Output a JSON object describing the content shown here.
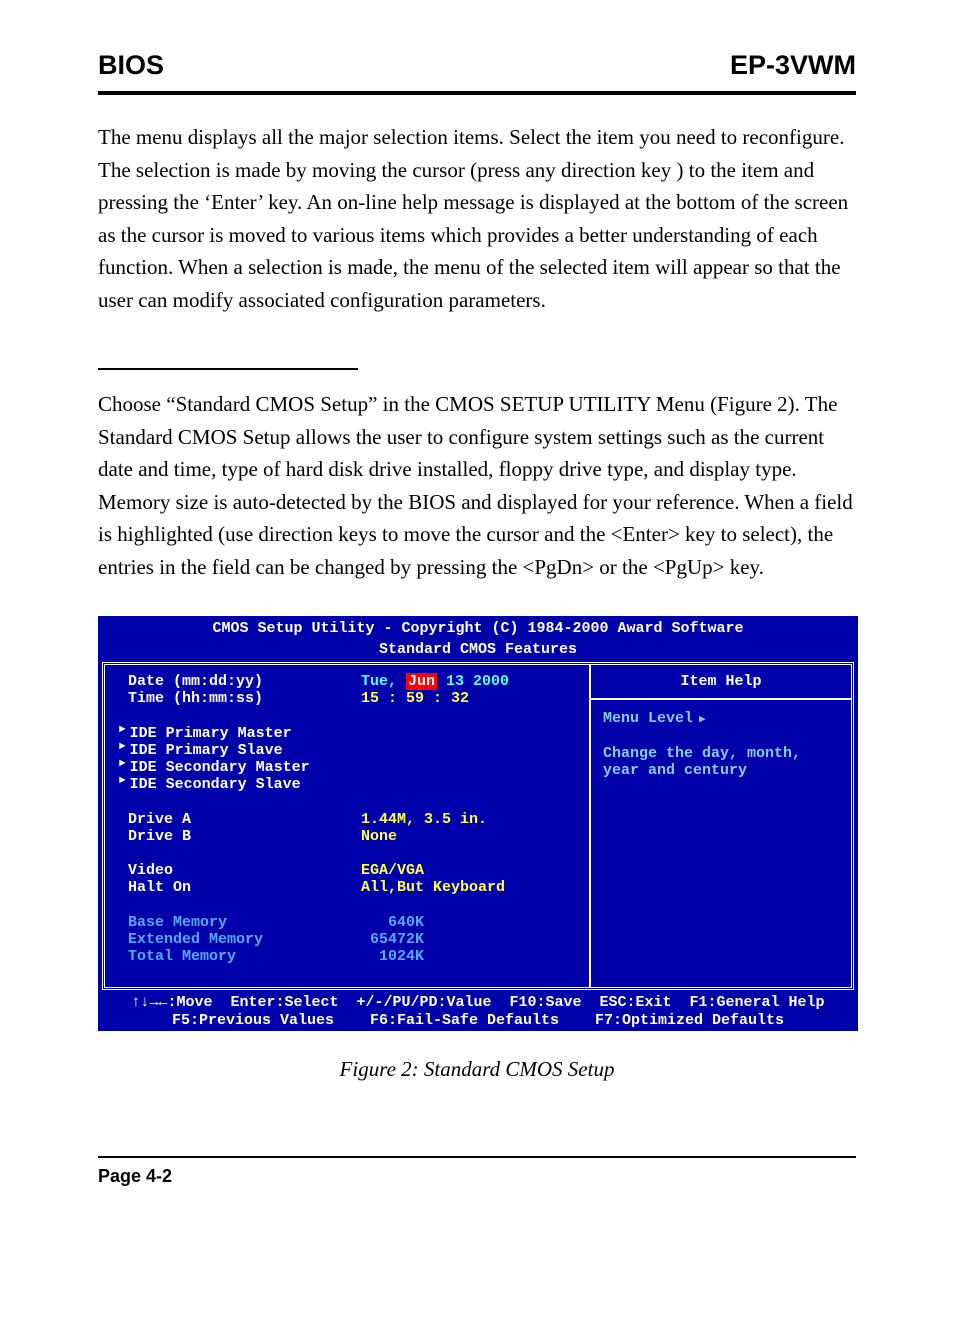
{
  "header": {
    "left": "BIOS",
    "right": "EP-3VWM"
  },
  "para1": "The menu displays all the major selection items. Select the item you need to reconfigure. The selection is made by moving the cursor (press any direction key ) to the item and pressing the ‘Enter’ key. An on-line help message is displayed at the bottom of the screen as the cursor is moved to various items which provides a better understanding of each function. When a selection is made, the menu of the selected item will appear so that the user can modify associated configuration parameters.",
  "para2": "Choose “Standard CMOS Setup” in the CMOS SETUP UTILITY Menu (Figure 2). The  Standard CMOS Setup allows the user to configure system settings such as the current date and time, type of hard disk drive installed, floppy drive type, and display type. Memory size is auto-detected by the BIOS and displayed for your reference. When a field is highlighted (use direction keys to move the cursor and the <Enter> key to select), the entries in the field can be changed by pressing the <PgDn> or the <PgUp> key.",
  "caption": "Figure 2:  Standard CMOS Setup",
  "footer_page": "Page 4-2",
  "bios": {
    "title1": "CMOS Setup Utility - Copyright (C) 1984-2000 Award Software",
    "title2": "Standard CMOS Features",
    "date_label": "Date (mm:dd:yy)",
    "date_pre": "Tue, ",
    "date_hl": "Jun",
    "date_post": " 13 2000",
    "time_label": "Time (hh:mm:ss)",
    "time_value": "15 : 59 : 32",
    "ide": {
      "0": "IDE Primary Master",
      "1": "IDE Primary Slave",
      "2": "IDE Secondary Master",
      "3": "IDE Secondary Slave"
    },
    "drivea_label": "Drive A",
    "drivea_value": "1.44M, 3.5 in.",
    "driveb_label": "Drive B",
    "driveb_value": "None",
    "video_label": "Video",
    "video_value": "EGA/VGA",
    "halt_label": "Halt On",
    "halt_value": "All,But Keyboard",
    "base_label": "Base Memory",
    "base_value": "   640K",
    "ext_label": "Extended Memory",
    "ext_value": " 65472K",
    "total_label": "Total Memory",
    "total_value": "  1024K",
    "help_title": "Item Help",
    "menu_level": "Menu Level",
    "help_text1": "Change the day, month,",
    "help_text2": "year and century",
    "footline1": "↑↓→←:Move  Enter:Select  +/-/PU/PD:Value  F10:Save  ESC:Exit  F1:General Help",
    "footline2": "F5:Previous Values    F6:Fail-Safe Defaults    F7:Optimized Defaults"
  }
}
